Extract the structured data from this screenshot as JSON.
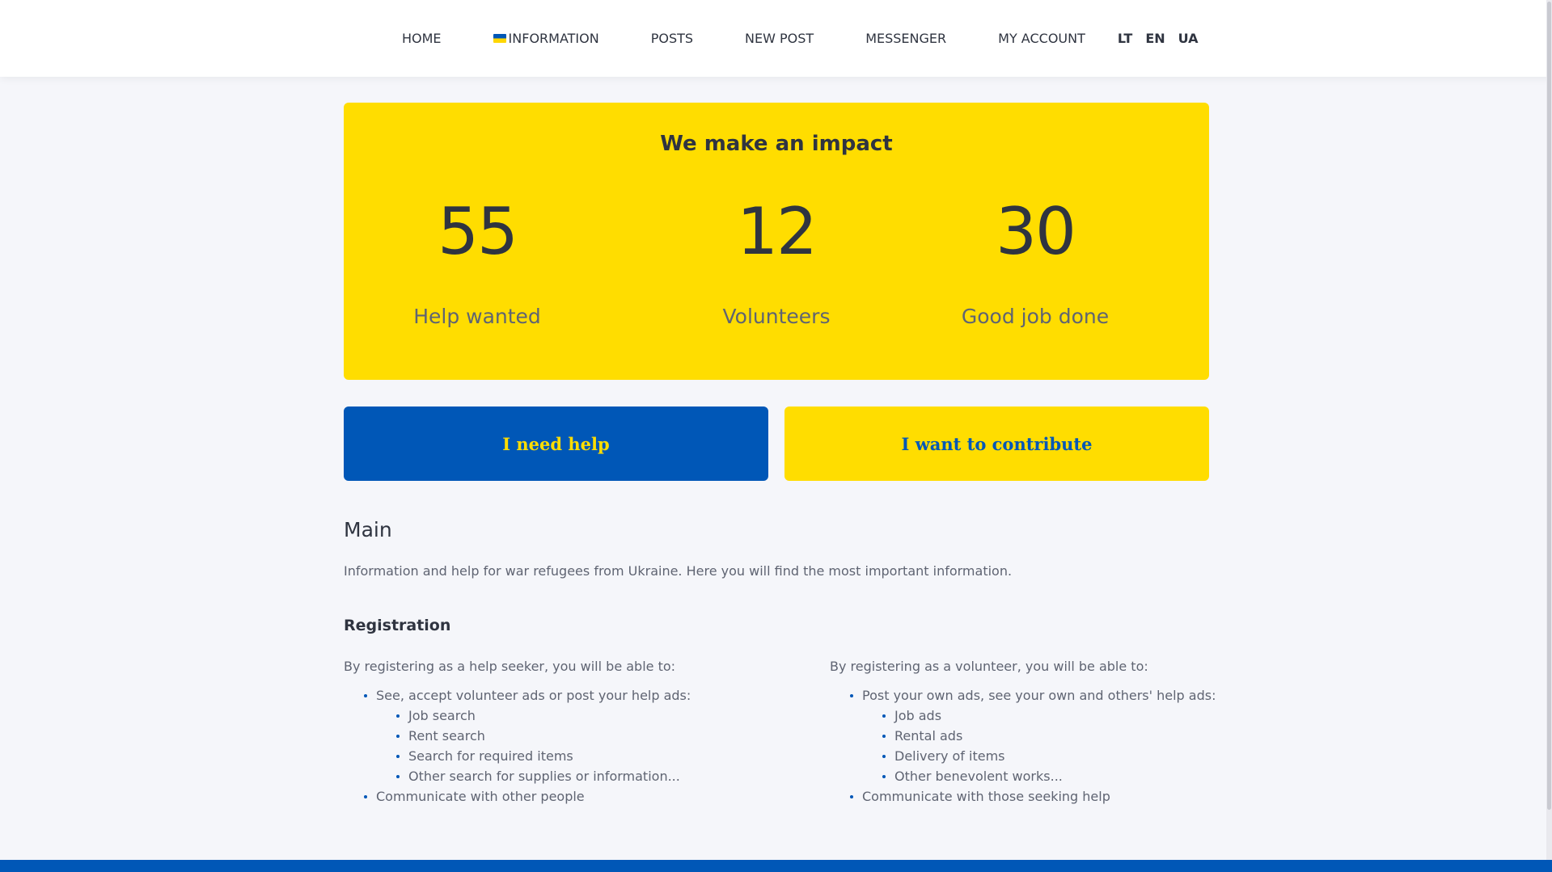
{
  "nav": {
    "items": [
      {
        "label": "HOME"
      },
      {
        "label": "INFORMATION",
        "icon": "ukraine-flag-icon"
      },
      {
        "label": "POSTS"
      },
      {
        "label": "NEW POST"
      },
      {
        "label": "MESSENGER"
      },
      {
        "label": "MY ACCOUNT"
      }
    ],
    "languages": [
      "LT",
      "EN",
      "UA"
    ]
  },
  "impact": {
    "title": "We make an impact",
    "stats": [
      {
        "value": "55",
        "label": "Help wanted"
      },
      {
        "value": "12",
        "label": "Volunteers"
      },
      {
        "value": "30",
        "label": "Good job done"
      }
    ]
  },
  "actions": {
    "help_label": "I need help",
    "contribute_label": "I want to contribute"
  },
  "main": {
    "heading": "Main",
    "intro": "Information and help for war refugees from Ukraine. Here you will find the most important information."
  },
  "registration": {
    "heading": "Registration",
    "seeker": {
      "intro": "By registering as a help seeker, you will be able to:",
      "item1": "See, accept volunteer ads or post your help ads:",
      "subitems": [
        "Job search",
        "Rent search",
        "Search for required items",
        "Other search for supplies or information..."
      ],
      "item2": "Communicate with other people"
    },
    "volunteer": {
      "intro": "By registering as a volunteer, you will be able to:",
      "item1": "Post your own ads, see your own and others' help ads:",
      "subitems": [
        "Job ads",
        "Rental ads",
        "Delivery of items",
        "Other benevolent works..."
      ],
      "item2": "Communicate with those seeking help"
    }
  },
  "colors": {
    "accent_yellow": "#ffdd00",
    "accent_blue": "#0057b7",
    "background": "#f5f6fa"
  }
}
